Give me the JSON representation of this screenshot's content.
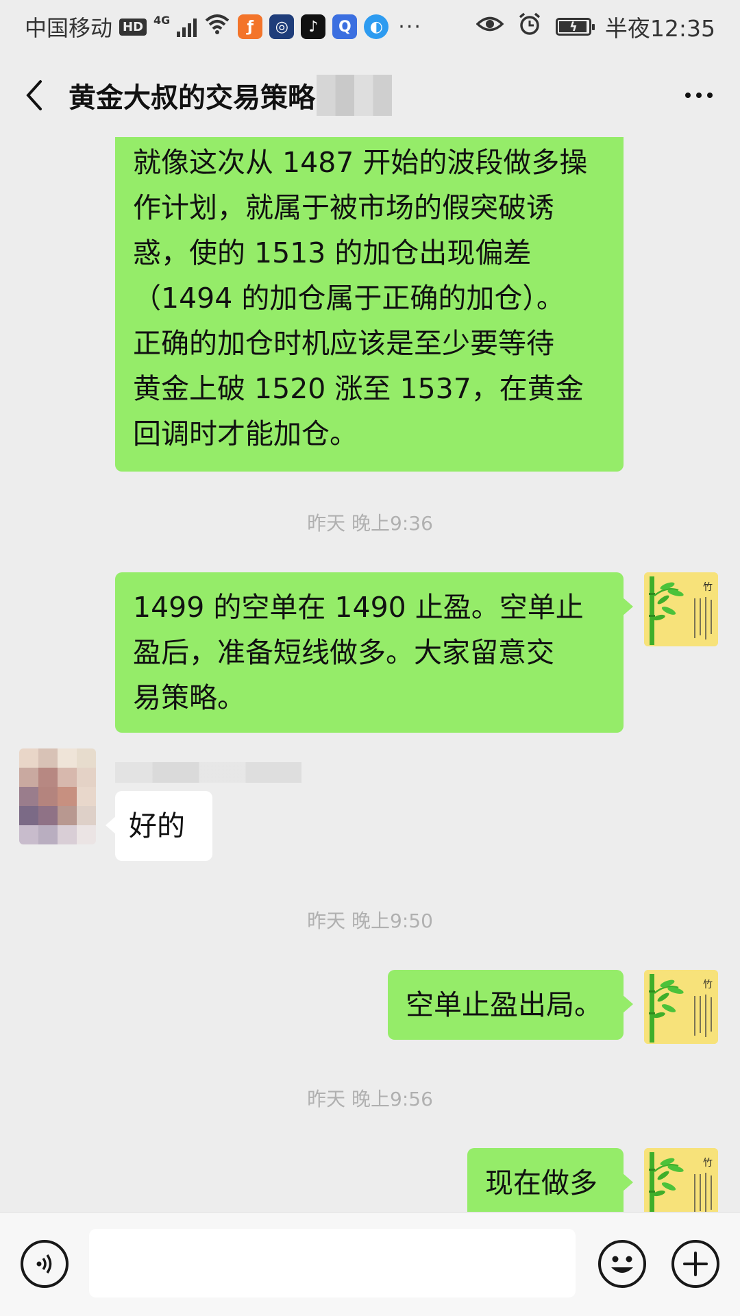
{
  "status_bar": {
    "carrier": "中国移动",
    "hd": "HD",
    "network": "4G",
    "more": "···",
    "time": "半夜12:35",
    "battery_level": 0.95,
    "app_icons": [
      {
        "name": "weibo-icon",
        "color": "#f3742a",
        "glyph": "ƒ"
      },
      {
        "name": "news-app-icon",
        "color": "#1f3d7a",
        "glyph": "◎"
      },
      {
        "name": "tiktok-icon",
        "color": "#111111",
        "glyph": "♪"
      },
      {
        "name": "browser-icon",
        "color": "#3b6fe0",
        "glyph": "Q"
      },
      {
        "name": "cloud-app-icon",
        "color": "#2d9bf0",
        "glyph": "◐"
      }
    ]
  },
  "header": {
    "title": "黄金大叔的交易策略"
  },
  "messages": [
    {
      "type": "text",
      "side": "right",
      "lines": [
        "就像这次从 1487 开始的波段做多操",
        "作计划，就属于被市场的假突破诱",
        "惑，使的 1513 的加仓出现偏差",
        "（1494 的加仓属于正确的加仓）。",
        "正确的加仓时机应该是至少要等待",
        "黄金上破 1520 涨至 1537，在黄金",
        "回调时才能加仓。"
      ]
    },
    {
      "type": "time",
      "text": "昨天 晚上9:36"
    },
    {
      "type": "text",
      "side": "right",
      "lines": [
        "1499 的空单在 1490 止盈。空单止",
        "盈后，准备短线做多。大家留意交",
        "易策略。"
      ]
    },
    {
      "type": "text",
      "side": "left",
      "lines": [
        "好的"
      ]
    },
    {
      "type": "time",
      "text": "昨天 晚上9:50"
    },
    {
      "type": "text",
      "side": "right",
      "lines": [
        "空单止盈出局。"
      ]
    },
    {
      "type": "time",
      "text": "昨天 晚上9:56"
    },
    {
      "type": "text",
      "side": "right",
      "lines": [
        "现在做多"
      ]
    }
  ],
  "colors": {
    "background": "#ededed",
    "my_bubble": "#95ec69",
    "other_bubble": "#ffffff",
    "avatar_yellow": "#f7e27a",
    "bamboo_green": "#3fae2a"
  },
  "input_bar": {
    "voice_icon": "voice-icon",
    "emoji_icon": "emoji-icon",
    "plus_icon": "plus-icon",
    "value": ""
  }
}
